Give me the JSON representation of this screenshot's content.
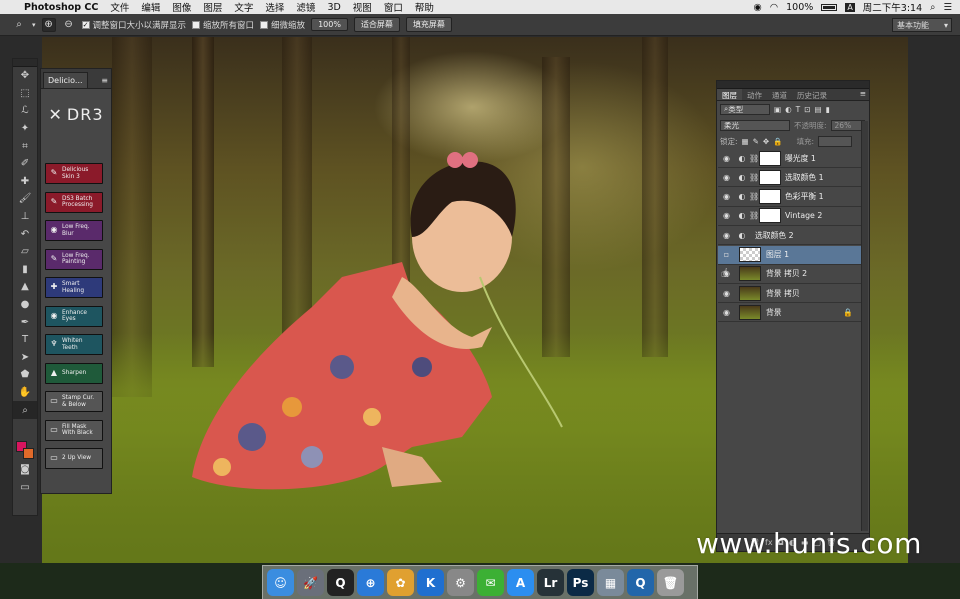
{
  "menubar": {
    "apple": "",
    "app": "Photoshop CC",
    "items": [
      "文件",
      "编辑",
      "图像",
      "图层",
      "文字",
      "选择",
      "滤镜",
      "3D",
      "视图",
      "窗口",
      "帮助"
    ],
    "battery": "100%",
    "clock": "周二下午3:14",
    "input_icon": "A"
  },
  "options": {
    "resize_windows": "调整窗口大小以满屏显示",
    "zoom_all": "缩放所有窗口",
    "scrubby": "细微缩放",
    "btn_100": "100%",
    "btn_fit": "适合屏幕",
    "btn_fill": "填充屏幕",
    "workspace": "基本功能"
  },
  "deli": {
    "tab": "Delicio...",
    "logo": "DR3",
    "buttons": [
      {
        "label1": "Delicious",
        "label2": "Skin 3",
        "color": "#8b1a2a",
        "icon": "✎"
      },
      {
        "label1": "DS3 Batch",
        "label2": "Processing",
        "color": "#8b1a2a",
        "icon": "✎"
      },
      {
        "label1": "Low Freq.",
        "label2": "Blur",
        "color": "#5a2a6b",
        "icon": "◉"
      },
      {
        "label1": "Low Freq.",
        "label2": "Painting",
        "color": "#5a2a6b",
        "icon": "✎"
      },
      {
        "label1": "Smart",
        "label2": "Healing",
        "color": "#2e3a7a",
        "icon": "✚"
      },
      {
        "label1": "Enhance",
        "label2": "Eyes",
        "color": "#1e5560",
        "icon": "◉"
      },
      {
        "label1": "Whiten",
        "label2": "Teeth",
        "color": "#1e5560",
        "icon": "♆"
      },
      {
        "label1": "Sharpen",
        "label2": "",
        "color": "#1f5a3a",
        "icon": "▲"
      },
      {
        "label1": "Stamp Cur.",
        "label2": "& Below",
        "color": "#555555",
        "icon": "▭"
      },
      {
        "label1": "Fill Mask",
        "label2": "With Black",
        "color": "#555555",
        "icon": "▭"
      },
      {
        "label1": "2 Up View",
        "label2": "",
        "color": "#555555",
        "icon": "▭"
      }
    ]
  },
  "layers": {
    "tabs": [
      "图层",
      "动作",
      "通道",
      "历史记录"
    ],
    "kind": "类型",
    "blend": "柔光",
    "opacity_label": "不透明度:",
    "opacity": "26%",
    "lock_label": "锁定:",
    "fill_label": "填充:",
    "fill": "",
    "rows": [
      {
        "name": "曝光度 1",
        "type": "adjust",
        "adj": "◐"
      },
      {
        "name": "选取颜色 1",
        "type": "adjust",
        "adj": "◐"
      },
      {
        "name": "色彩平衡 1",
        "type": "adjust",
        "adj": "◐"
      },
      {
        "name": "Vintage 2",
        "type": "adjust",
        "adj": "◐"
      },
      {
        "name": "选取颜色 2",
        "type": "adjonly",
        "adj": "◐"
      },
      {
        "name": "图层 1",
        "type": "selected",
        "adj": ""
      },
      {
        "name": "背景 拷贝 2",
        "type": "photo",
        "adj": ""
      },
      {
        "name": "背景 拷贝",
        "type": "photo",
        "adj": ""
      },
      {
        "name": "背景",
        "type": "photo-locked",
        "adj": ""
      }
    ]
  },
  "dock": [
    {
      "name": "finder",
      "label": "☺",
      "color": "#3a8de0"
    },
    {
      "name": "launchpad",
      "label": "🚀",
      "color": "#6a6f7a"
    },
    {
      "name": "qq",
      "label": "Q",
      "color": "#222222"
    },
    {
      "name": "safari",
      "label": "⊕",
      "color": "#2a7ad8"
    },
    {
      "name": "photos",
      "label": "✿",
      "color": "#e0a030"
    },
    {
      "name": "kuaiyong",
      "label": "K",
      "color": "#1f6fd0"
    },
    {
      "name": "system-prefs",
      "label": "⚙",
      "color": "#888888"
    },
    {
      "name": "wechat",
      "label": "✉",
      "color": "#3cb034"
    },
    {
      "name": "app-store",
      "label": "A",
      "color": "#2b8ef0"
    },
    {
      "name": "lightroom",
      "label": "Lr",
      "color": "#263238"
    },
    {
      "name": "photoshop",
      "label": "Ps",
      "color": "#0b2a46"
    },
    {
      "name": "preview",
      "label": "▦",
      "color": "#7a8a9a"
    },
    {
      "name": "quicktime",
      "label": "Q",
      "color": "#2266aa"
    },
    {
      "name": "trash",
      "label": "🗑",
      "color": "#9a9a9a"
    }
  ],
  "watermark": "www.hunis.com"
}
